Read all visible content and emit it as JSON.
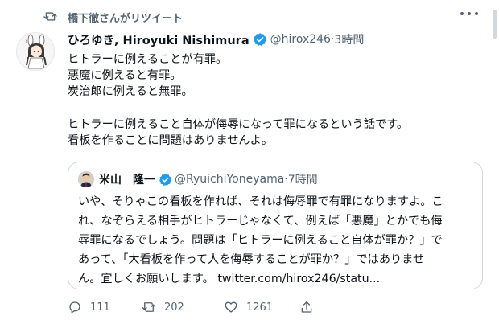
{
  "retweet": {
    "text": "橋下徹さんがリツイート",
    "icon": "retweet-icon"
  },
  "tweet": {
    "author_name": "ひろゆき, Hiroyuki Nishimura",
    "handle": "@hirox246",
    "separator": "·",
    "time": "3時間",
    "lines": [
      "ヒトラーに例えることが有罪。",
      "悪魔に例えると有罪。",
      "炭治郎に例えると無罪。",
      "",
      "ヒトラーに例えること自体が侮辱になって罪になるという話です。",
      "看板を作ることに問題はありませんよ。"
    ]
  },
  "quote": {
    "author_name": "米山　隆一",
    "handle": "@RyuichiYoneyama",
    "separator": "·",
    "time": "7時間",
    "lines": [
      "いや、そりゃこの看板を作れば、それは侮辱罪で有罪になりますよ。こ",
      "れ、なぞらえる相手がヒトラーじゃなくて、例えば「悪魔」とかでも侮",
      "辱罪になるでしょう。問題は「ヒトラーに例えること自体が罪か？」で",
      "あって、「大看板を作って人を侮辱することが罪か？」ではありませ",
      "ん。宜しくお願いします。 twitter.com/hirox246/statu..."
    ]
  },
  "actions": {
    "reply_count": "111",
    "retweet_count": "202",
    "like_count": "1261"
  },
  "colors": {
    "verified": "#1d9bf0",
    "secondary_text": "#536471",
    "border": "#cfd9de"
  }
}
